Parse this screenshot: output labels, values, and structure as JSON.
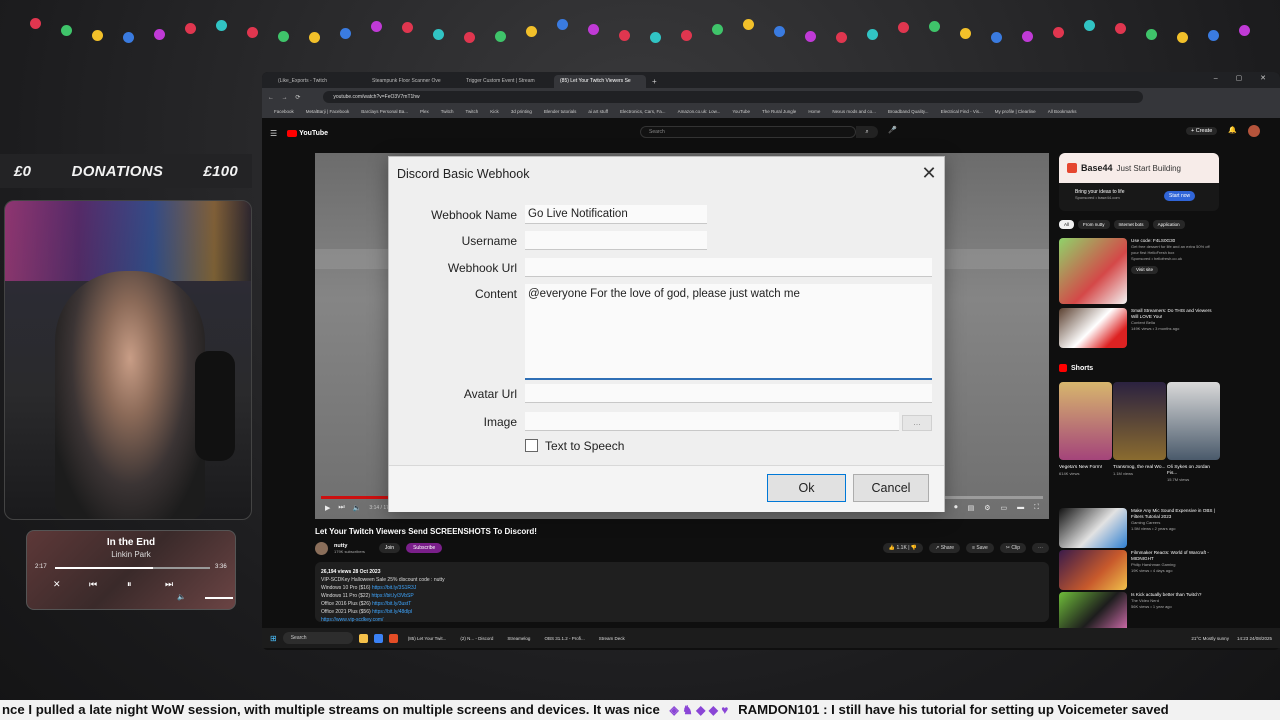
{
  "donations": {
    "left": "£0",
    "label": "DONATIONS",
    "right": "£100"
  },
  "music": {
    "title": "In the End",
    "artist": "Linkin Park",
    "elapsed": "2:17",
    "total": "3:36",
    "progress": 0.63
  },
  "browser": {
    "tabs": [
      "(Like_Exports - Twitch",
      "Steampunk Floor Scanner Ove",
      "Trigger Custom Event | Stream",
      "(85) Let Your Twitch Viewers Se"
    ],
    "url": "youtube.com/watch?v=FeO3V7mT1hw",
    "bookmarks": [
      "Facebook",
      "MetalBarji | Facebook",
      "Barclays Personal Ba...",
      "Plex",
      "Twitch",
      "Twitch",
      "Kick",
      "3d printing",
      "Blender tutorials",
      "ai art stuff",
      "Electronics, Cars, Fa...",
      "Amazon.co.uk: Low...",
      "YouTube",
      "The Rural Jungle",
      "Home",
      "Nexus mods and co...",
      "Broadband Quality...",
      "Electrical Find - Vis...",
      "My profile | Clearline",
      "All Bookmarks"
    ]
  },
  "youtube": {
    "logo": "YouTube",
    "search_placeholder": "Search",
    "create": "Create",
    "video_title": "Let Your Twitch Viewers Send SCREENSHOTS To Discord!",
    "channel": "nutty",
    "subs": "179K subscribers",
    "join": "Join",
    "subscribe": "Subscribe",
    "likes": "1.1K",
    "share": "Share",
    "save": "Save",
    "clip": "Clip",
    "player_time": "3:14 / 17:36 • Basic Discord Message",
    "desc_stats": "26,194 views  28 Oct 2023",
    "desc_lines": [
      "VIP-SCDKey Halloween Sale 25% discount code : nutty",
      "Windows 10 Pro ($16) ",
      "Windows 11 Pro ($22) ",
      "Office 2016 Plus ($26) ",
      "Office 2021 Plus ($56) "
    ],
    "desc_links": [
      "https://bit.ly/3S1R3J",
      "https://bit.ly/3VbSP",
      "https://bit.ly/3ustT",
      "https://bit.ly/48dlpI"
    ],
    "desc_more": "https://www.vip-scdkey.com/",
    "ad": {
      "brand": "Base44",
      "tagline": "Just Start Building",
      "text": "Bring your ideas to life",
      "sponsored": "Sponsored • base44.com",
      "cta": "Start now"
    },
    "chips": [
      "All",
      "From nutty",
      "Internet bots",
      "Application"
    ],
    "side_items": [
      {
        "title": "Use code: F4LS0G30",
        "sub": "Get free dessert for life and an extra 50% off your first HelloFresh box",
        "channel": "Sponsored • hellofresh.co.uk",
        "cta": "Visit site"
      },
      {
        "title": "Small Streamers: Do THIS and Viewers Will LOVE You!",
        "sub": "Content Bella",
        "channel": "149K views • 3 months ago",
        "cta": ""
      }
    ],
    "shorts_title": "Shorts",
    "shorts": [
      {
        "title": "Vegeta's New Form!",
        "views": "614K views"
      },
      {
        "title": "Transmog, the real Wo...",
        "views": "1.1M views"
      },
      {
        "title": "Oli Sykes on Jordan Fis...",
        "views": "15.7M views"
      }
    ],
    "side_items2": [
      {
        "title": "Make Any Mic Sound Expensive in OBS | Filters Tutorial 2023",
        "sub": "Gaming Careers",
        "channel": "1.5M views • 2 years ago"
      },
      {
        "title": "Filmmaker Reacts: World of Warcraft - MIDNIGHT",
        "sub": "Philip Harshman Gaming",
        "channel": "19K views • 4 days ago"
      },
      {
        "title": "Is Kick actually better than Twitch?",
        "sub": "The Video Nerd",
        "channel": "56K views • 1 year ago"
      }
    ]
  },
  "dialog": {
    "title": "Discord Basic Webhook",
    "close": "✕",
    "labels": {
      "webhook_name": "Webhook Name",
      "username": "Username",
      "webhook_url": "Webhook Url",
      "content": "Content",
      "avatar_url": "Avatar Url",
      "image": "Image",
      "tts": "Text to Speech"
    },
    "values": {
      "webhook_name": "Go Live Notification",
      "username": "",
      "webhook_url": "",
      "content": "@everyone For the love of god, please just watch me",
      "avatar_url": "",
      "image": ""
    },
    "browse": "...",
    "tts_checked": false,
    "ok": "Ok",
    "cancel": "Cancel"
  },
  "taskbar": {
    "search": "Search",
    "apps": [
      "(85) Let Your Twit...",
      "(2) N... - Discord",
      "Streamelog",
      "OBS 31.1.2 - Profi...",
      "Stream Deck"
    ],
    "weather": "21°C Mostly sunny",
    "clock": "14:23 24/08/2025"
  },
  "chat_ticker": {
    "text_a": "nce I pulled a late night WoW session, with multiple streams on multiple screens and devices. It was nice",
    "text_b": "RAMDON101 :  I still have his tutorial for setting up Voicemeter saved"
  }
}
